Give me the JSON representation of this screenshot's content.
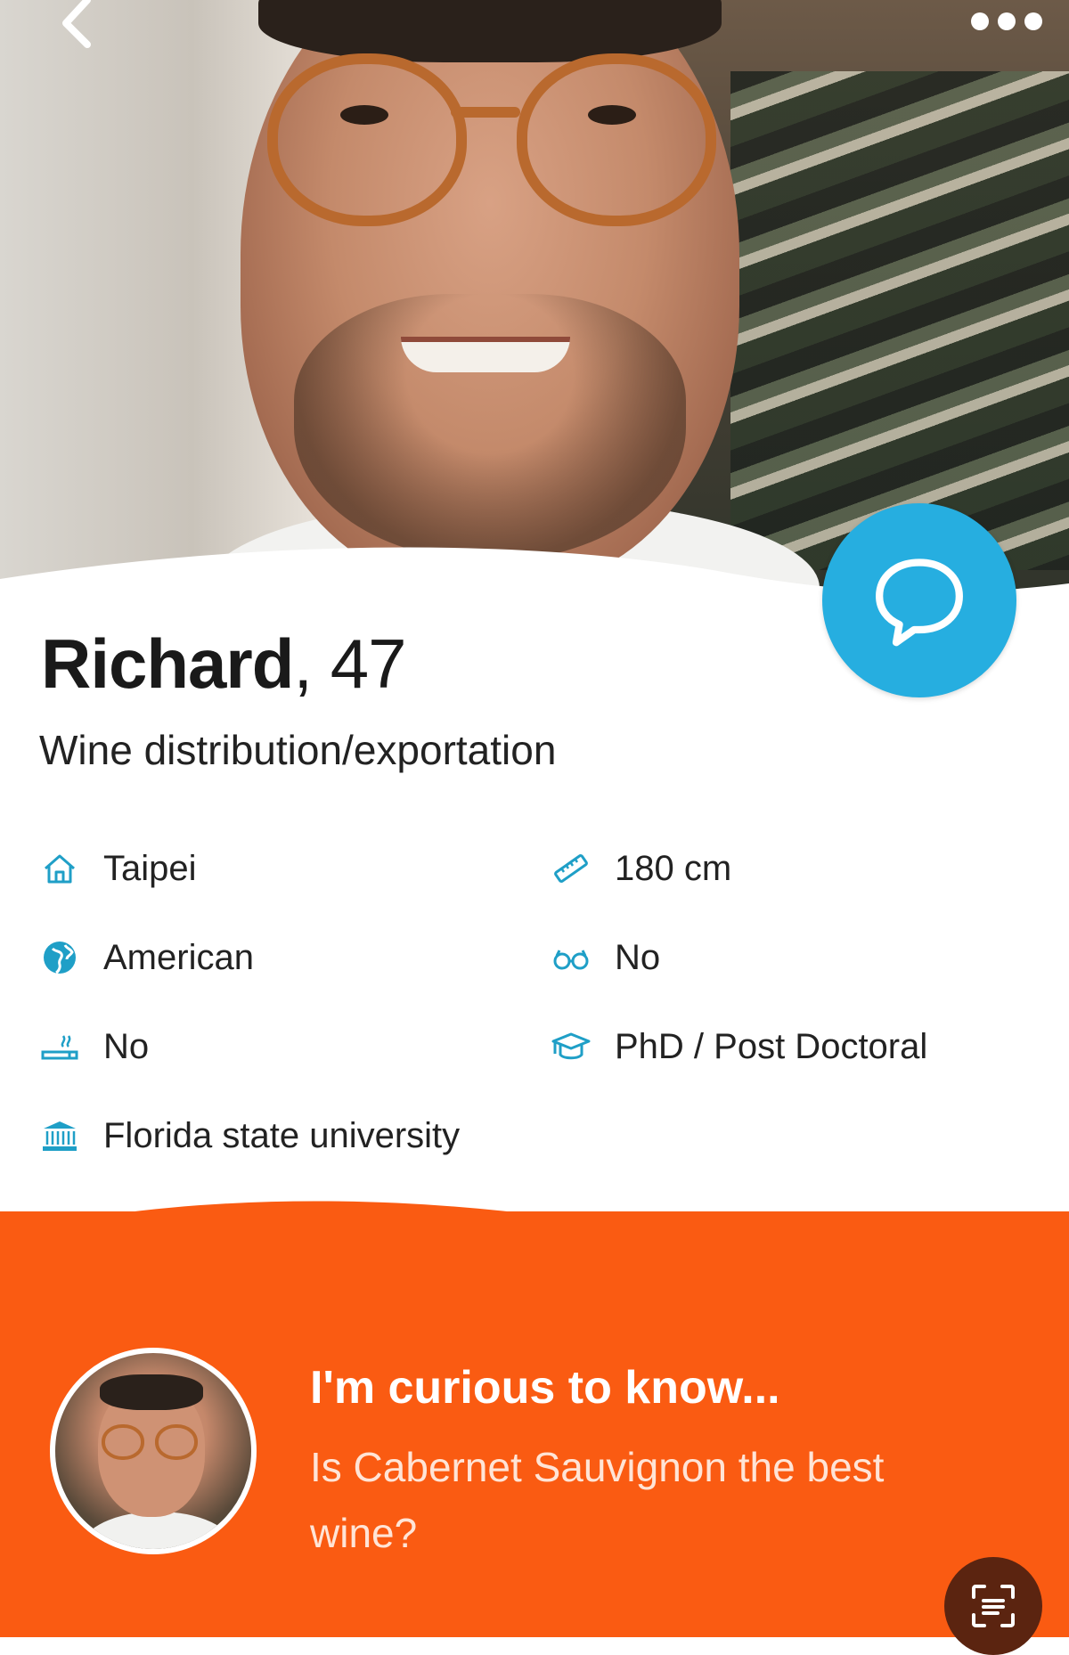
{
  "profile": {
    "name": "Richard",
    "age_text": ", 47",
    "occupation": "Wine distribution/exportation"
  },
  "facts": [
    {
      "icon": "home-icon",
      "label": "Taipei"
    },
    {
      "icon": "ruler-icon",
      "label": "180 cm"
    },
    {
      "icon": "globe-icon",
      "label": "American"
    },
    {
      "icon": "glasses-icon",
      "label": "No"
    },
    {
      "icon": "smoking-icon",
      "label": "No"
    },
    {
      "icon": "graduation-cap-icon",
      "label": "PhD / Post Doctoral"
    },
    {
      "icon": "university-icon",
      "label": "Florida state university"
    }
  ],
  "question": {
    "title": "I'm curious to know...",
    "text": "Is Cabernet Sauvignon the best wine?"
  },
  "colors": {
    "accent_teal": "#26aee0",
    "orange_bg": "#fa5b12",
    "icon_teal": "#1f9fc7"
  }
}
